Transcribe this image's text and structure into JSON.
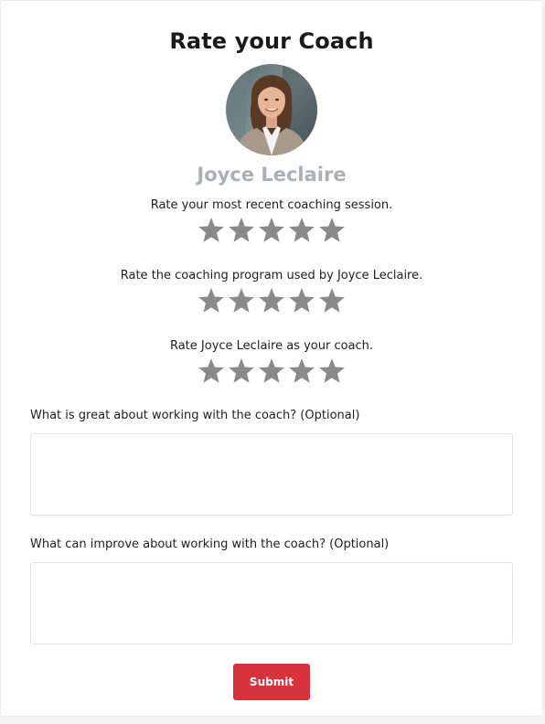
{
  "page": {
    "title": "Rate your Coach"
  },
  "coach": {
    "name": "Joyce Leclaire",
    "avatar_icon": "coach-photo"
  },
  "ratings": [
    {
      "label": "Rate your most recent coaching session.",
      "max_stars": 5,
      "value": 0
    },
    {
      "label": "Rate the coaching program used by Joyce Leclaire.",
      "max_stars": 5,
      "value": 0
    },
    {
      "label": "Rate Joyce Leclaire as your coach.",
      "max_stars": 5,
      "value": 0
    }
  ],
  "questions": [
    {
      "label": "What is great about working with the coach? (Optional)",
      "value": "",
      "placeholder": ""
    },
    {
      "label": "What can improve about working with the coach? (Optional)",
      "value": "",
      "placeholder": ""
    }
  ],
  "submit": {
    "label": "Submit"
  },
  "colors": {
    "accent": "#d6333d",
    "star_empty": "#8a8a8a",
    "name": "#a9b0b8"
  }
}
